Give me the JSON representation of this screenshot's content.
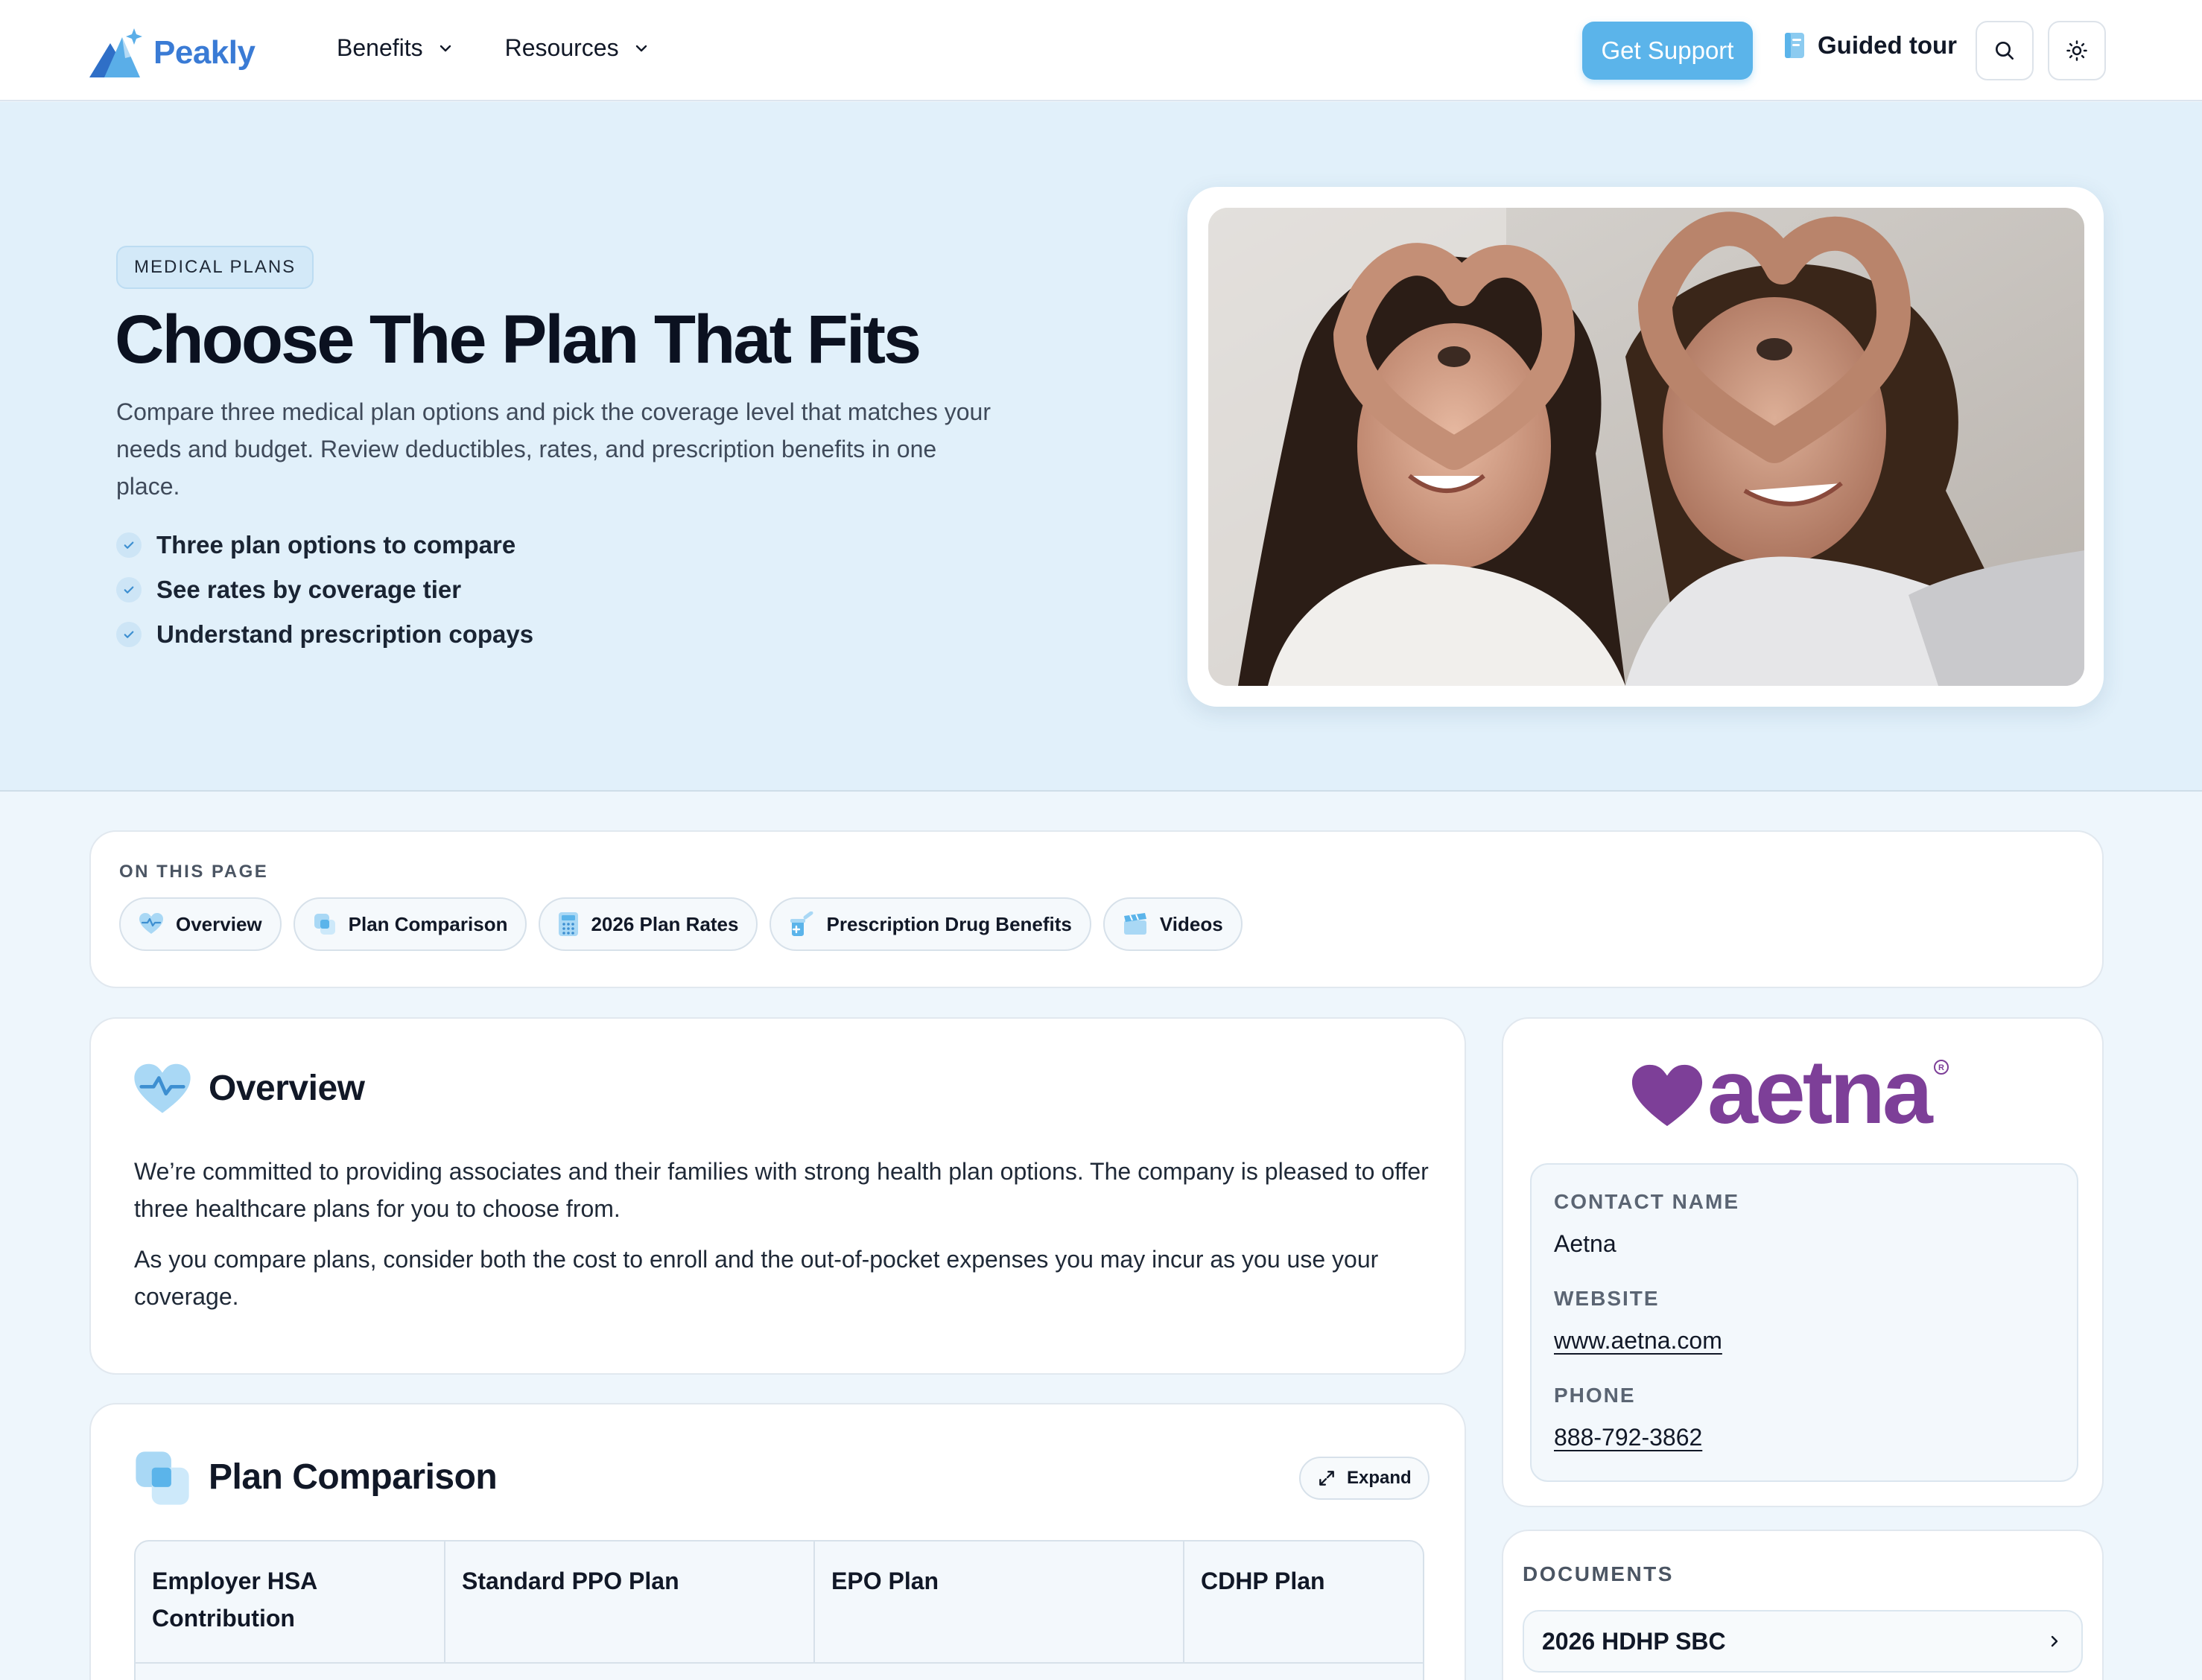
{
  "header": {
    "logo_text": "Peakly",
    "nav": [
      {
        "label": "Benefits",
        "icon": "chevron-down-icon"
      },
      {
        "label": "Resources",
        "icon": "chevron-down-icon"
      }
    ],
    "support_label": "Get Support",
    "guided_tour_label": "Guided tour",
    "search_icon": "search-icon",
    "theme_icon": "sun-icon"
  },
  "hero": {
    "badge": "MEDICAL PLANS",
    "title": "Choose The Plan That Fits",
    "subtitle": "Compare three medical plan options and pick the coverage level that matches your needs and budget. Review deductibles, rates, and prescription benefits in one place.",
    "bullets": [
      "Three plan options to compare",
      "See rates by coverage tier",
      "Understand prescription copays"
    ],
    "image_alt": "Mother and daughter making heart shapes with their hands"
  },
  "on_this_page": {
    "label": "ON THIS PAGE",
    "chips": [
      {
        "label": "Overview",
        "icon": "heart-pulse-icon"
      },
      {
        "label": "Plan Comparison",
        "icon": "layers-icon"
      },
      {
        "label": "2026 Plan Rates",
        "icon": "calculator-icon"
      },
      {
        "label": "Prescription Drug Benefits",
        "icon": "pill-bottle-icon"
      },
      {
        "label": "Videos",
        "icon": "clapperboard-icon"
      }
    ]
  },
  "overview": {
    "title": "Overview",
    "paragraphs": [
      "We’re committed to providing associates and their families with strong health plan options. The company is pleased to offer three healthcare plans for you to choose from.",
      "As you compare plans, consider both the cost to enroll and the out-of-pocket expenses you may incur as you use your coverage."
    ]
  },
  "plan_comparison": {
    "title": "Plan Comparison",
    "expand_label": "Expand",
    "columns": [
      "Employer HSA Contribution",
      "Standard PPO Plan",
      "EPO Plan",
      "CDHP Plan"
    ]
  },
  "contact": {
    "brand": "aetna",
    "brand_color": "#7d3f98",
    "contact_name_label": "CONTACT NAME",
    "contact_name": "Aetna",
    "website_label": "WEBSITE",
    "website": "www.aetna.com",
    "phone_label": "PHONE",
    "phone": "888-792-3862"
  },
  "documents": {
    "label": "DOCUMENTS",
    "items": [
      "2026 HDHP SBC"
    ]
  },
  "colors": {
    "accent": "#5bb4ea",
    "hero_bg": "#e1f0fa",
    "page_bg": "#eef6fc"
  }
}
